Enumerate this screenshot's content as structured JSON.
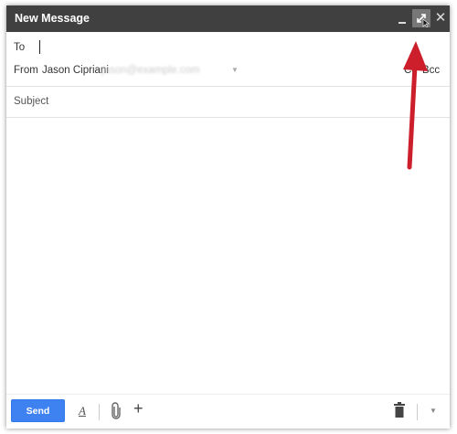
{
  "window": {
    "title": "New Message",
    "minimize_icon": "minimize-icon",
    "expand_icon": "expand-fullscreen-icon",
    "close_icon": "close-icon",
    "titlebar_color": "#404040"
  },
  "compose": {
    "to_label": "To",
    "to_value": "",
    "from_label": "From",
    "from_name": "Jason Cipriani",
    "from_email_blurred": "jason@example.com",
    "cc_label": "Cc",
    "bcc_label": "Bcc",
    "subject_placeholder": "Subject",
    "body_value": ""
  },
  "toolbar": {
    "send_label": "Send",
    "format_label": "A",
    "more_label": "+",
    "send_color": "#3e81f0"
  },
  "annotation": {
    "arrow_color": "#cc1f2b"
  }
}
